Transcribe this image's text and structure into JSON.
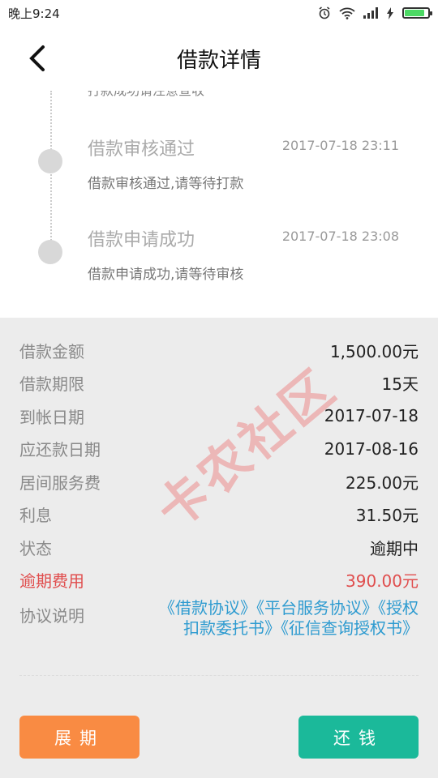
{
  "status_bar": {
    "time": "晚上9:24"
  },
  "header": {
    "title": "借款详情"
  },
  "timeline": {
    "partial_text": "打款成功请注意查收",
    "items": [
      {
        "title": "借款审核通过",
        "time": "2017-07-18 23:11",
        "desc": "借款审核通过,请等待打款"
      },
      {
        "title": "借款申请成功",
        "time": "2017-07-18 23:08",
        "desc": "借款申请成功,请等待审核"
      }
    ]
  },
  "details": {
    "rows": [
      {
        "label": "借款金额",
        "value": "1,500.00元"
      },
      {
        "label": "借款期限",
        "value": "15天"
      },
      {
        "label": "到帐日期",
        "value": "2017-07-18"
      },
      {
        "label": "应还款日期",
        "value": "2017-08-16"
      },
      {
        "label": "居间服务费",
        "value": "225.00元"
      },
      {
        "label": "利息",
        "value": "31.50元"
      },
      {
        "label": "状态",
        "value": "逾期中"
      },
      {
        "label": "逾期费用",
        "value": "390.00元"
      }
    ],
    "agreements": {
      "label": "协议说明",
      "links": [
        "《借款协议》",
        "《平台服务协议》",
        "《授权扣款委托书》",
        "《征信查询授权书》"
      ]
    }
  },
  "buttons": {
    "extend": "展期",
    "repay": "还钱"
  },
  "watermark": "卡农社区",
  "colors": {
    "overdue": "#e04e4e",
    "link": "#2e9bd0",
    "extend_button": "#f98b43",
    "repay_button": "#1bb99a"
  }
}
